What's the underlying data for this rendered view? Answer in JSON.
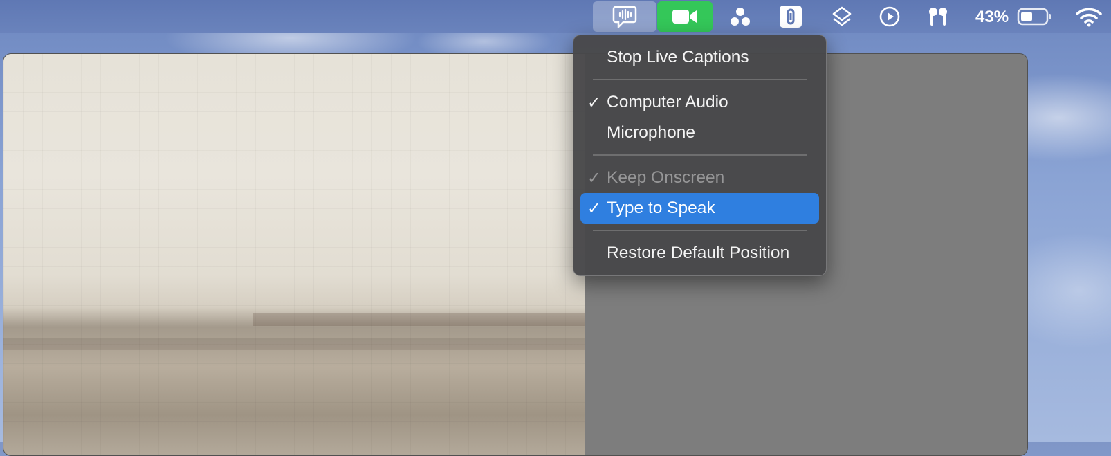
{
  "menubar": {
    "battery_percent": "43%",
    "icons": [
      "live-captions-icon",
      "facetime-video-icon",
      "control-dots-icon",
      "one-password-icon",
      "stack-layers-icon",
      "play-circle-icon",
      "airpods-icon",
      "battery-icon",
      "wifi-icon"
    ],
    "accent_video": "#34c759"
  },
  "menu": {
    "items": [
      {
        "label": "Stop Live Captions",
        "checked": false,
        "disabled": false
      },
      {
        "label": "Computer Audio",
        "checked": true,
        "disabled": false
      },
      {
        "label": "Microphone",
        "checked": false,
        "disabled": false
      },
      {
        "label": "Keep Onscreen",
        "checked": true,
        "disabled": true
      },
      {
        "label": "Type to Speak",
        "checked": true,
        "disabled": false,
        "highlighted": true
      },
      {
        "label": "Restore Default Position",
        "checked": false,
        "disabled": false
      }
    ],
    "check_glyph": "✓",
    "highlight_color": "#2f7fe0"
  }
}
